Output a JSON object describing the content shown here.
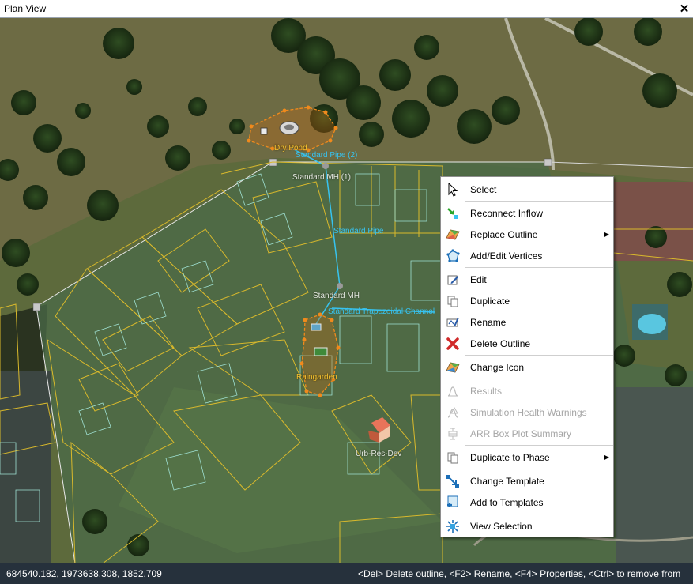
{
  "window": {
    "title": "Plan View",
    "close_glyph": "✕"
  },
  "map": {
    "labels": {
      "dry_pond": "Dry Pond",
      "standard_pipe_2": "Standard Pipe (2)",
      "standard_mh_1": "Standard MH (1)",
      "standard_pipe": "Standard Pipe",
      "standard_mh": "Standard MH",
      "channel_overlap": "Standard Trapezoidal Channel",
      "raingarden": "Raingarden",
      "urb_res_dev": "Urb-Res-Dev"
    },
    "colors": {
      "parcel_outline": "#d9b92c",
      "pipe": "#37c3f0",
      "pond_outline": "#f08a1c",
      "catchment": "#ffffff"
    }
  },
  "context_menu": {
    "items": [
      {
        "label": "Select",
        "icon": "cursor-arrow-icon",
        "enabled": true
      },
      {
        "label": "Reconnect Inflow",
        "icon": "reconnect-icon",
        "enabled": true
      },
      {
        "label": "Replace Outline",
        "icon": "outline-map-icon",
        "enabled": true,
        "submenu": true
      },
      {
        "label": "Add/Edit Vertices",
        "icon": "vertices-icon",
        "enabled": true
      },
      {
        "label": "Edit",
        "icon": "edit-icon",
        "enabled": true
      },
      {
        "label": "Duplicate",
        "icon": "duplicate-icon",
        "enabled": true
      },
      {
        "label": "Rename",
        "icon": "rename-icon",
        "enabled": true
      },
      {
        "label": "Delete Outline",
        "icon": "delete-x-icon",
        "enabled": true
      },
      {
        "label": "Change Icon",
        "icon": "change-icon-icon",
        "enabled": true
      },
      {
        "label": "Results",
        "icon": "results-chart-icon",
        "enabled": false
      },
      {
        "label": "Simulation Health Warnings",
        "icon": "health-warning-icon",
        "enabled": false
      },
      {
        "label": "ARR Box Plot Summary",
        "icon": "box-plot-icon",
        "enabled": false
      },
      {
        "label": "Duplicate to Phase",
        "icon": "duplicate-phase-icon",
        "enabled": true,
        "submenu": true
      },
      {
        "label": "Change Template",
        "icon": "change-template-icon",
        "enabled": true
      },
      {
        "label": "Add to Templates",
        "icon": "add-template-icon",
        "enabled": true
      },
      {
        "label": "View Selection",
        "icon": "view-selection-icon",
        "enabled": true
      }
    ],
    "submenu_glyph": "▶"
  },
  "status_bar": {
    "coordinates": "684540.182, 1973638.308, 1852.709",
    "hint": "<Del> Delete outline, <F2> Rename, <F4> Properties, <Ctrl> to remove from"
  }
}
